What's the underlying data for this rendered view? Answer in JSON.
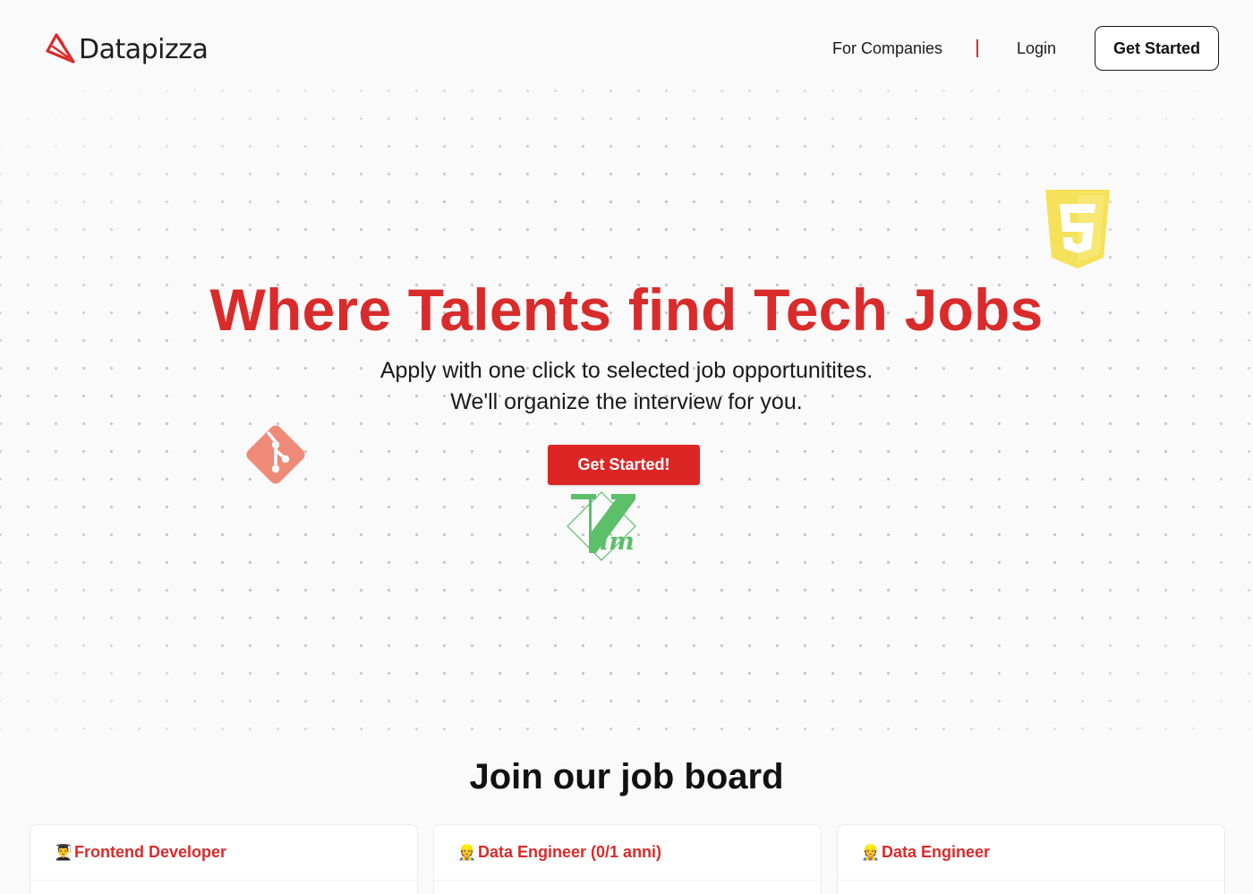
{
  "brand": {
    "name": "Datapizza",
    "accent": "#d92b2b"
  },
  "nav": {
    "for_companies": "For Companies",
    "login": "Login",
    "get_started": "Get Started"
  },
  "hero": {
    "title": "Where Talents find Tech Jobs",
    "subtitle_line1": "Apply with one click to selected job opportunitites.",
    "subtitle_line2": "We'll organize the interview for you.",
    "cta": "Get Started!",
    "floating_icons": [
      "html5-icon",
      "git-icon",
      "vim-icon"
    ]
  },
  "job_board": {
    "title": "Join our job board",
    "jobs": [
      {
        "emoji": "👨‍🎓",
        "title": "Frontend Developer"
      },
      {
        "emoji": "👷",
        "title": "Data Engineer (0/1 anni)"
      },
      {
        "emoji": "👷",
        "title": "Data Engineer"
      }
    ]
  }
}
